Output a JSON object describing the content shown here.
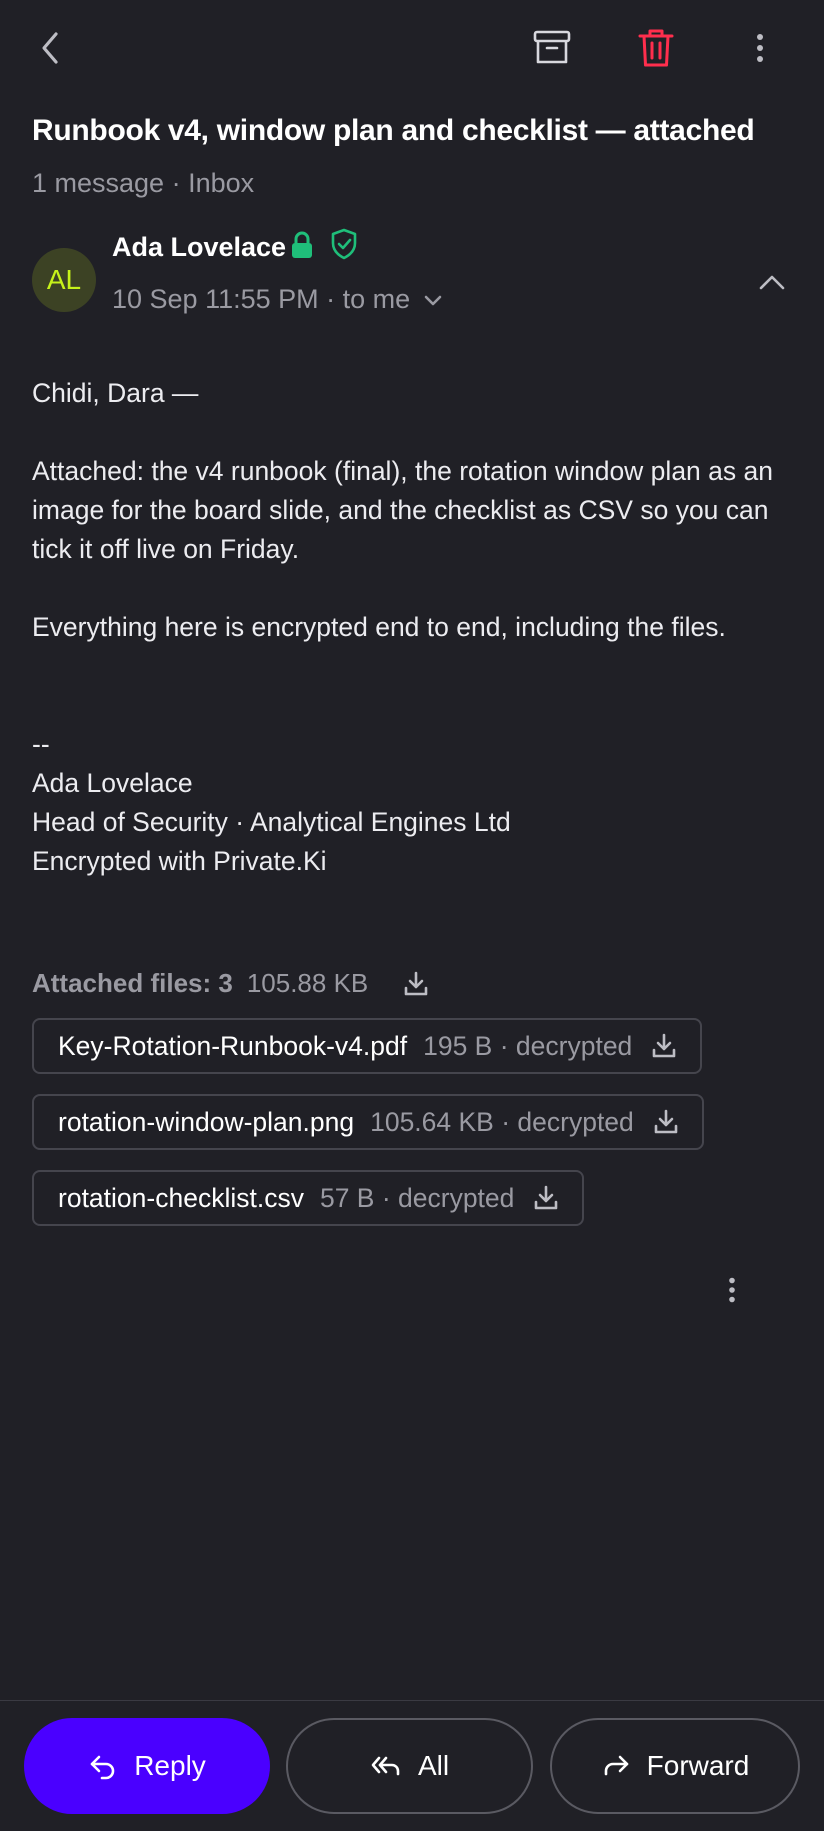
{
  "toolbar": {
    "back_icon": "chevron-left-icon",
    "archive_icon": "archive-icon",
    "delete_icon": "trash-icon",
    "more_icon": "more-vertical-icon",
    "delete_color": "#ff2e4d"
  },
  "message": {
    "subject": "Runbook v4, window plan and checklist — attached",
    "meta": "1 message · Inbox",
    "sender": {
      "initials": "AL",
      "name": "Ada Lovelace",
      "avatar_bg": "#3c4224",
      "avatar_fg": "#c6f21a",
      "badges": [
        "lock-icon",
        "shield-check-icon"
      ],
      "badge_color": "#1fbf7a"
    },
    "date_line": "10 Sep 11:55 PM · to me",
    "body": {
      "greeting": "Chidi, Dara —",
      "paragraph1": "Attached: the v4 runbook (final), the rotation window plan as an image for the board slide, and the checklist as CSV so you can tick it off live on Friday.",
      "paragraph2": "Everything here is encrypted end to end, including the files.",
      "sig_sep": "--",
      "sig_name": "Ada Lovelace",
      "sig_title": "Head of Security · Analytical Engines Ltd",
      "sig_note": "Encrypted with Private.Ki"
    }
  },
  "attachments": {
    "label": "Attached files: 3",
    "total_size": "105.88 KB",
    "files": [
      {
        "name": "Key-Rotation-Runbook-v4.pdf",
        "info": "195 B · decrypted"
      },
      {
        "name": "rotation-window-plan.png",
        "info": "105.64 KB · decrypted"
      },
      {
        "name": "rotation-checklist.csv",
        "info": "57 B · decrypted"
      }
    ]
  },
  "actions": {
    "reply_label": "Reply",
    "all_label": "All",
    "forward_label": "Forward",
    "accent": "#4a00ff"
  }
}
